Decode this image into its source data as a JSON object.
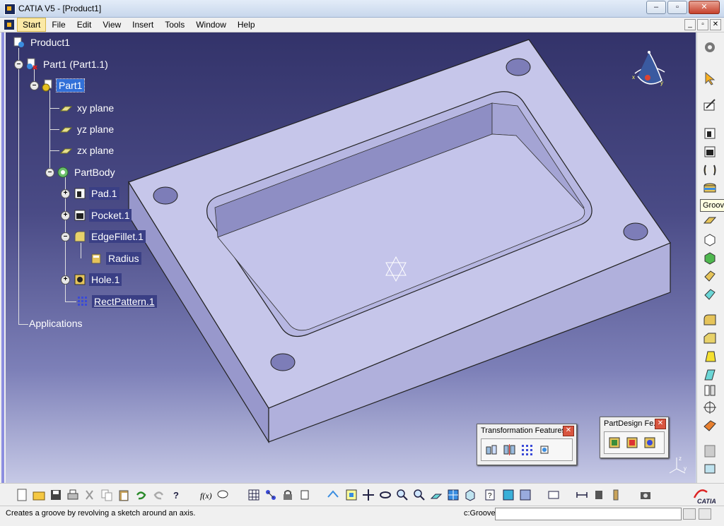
{
  "window": {
    "title": "CATIA V5 - [Product1]"
  },
  "menu": [
    "Start",
    "File",
    "Edit",
    "View",
    "Insert",
    "Tools",
    "Window",
    "Help"
  ],
  "tree": {
    "product": "Product1",
    "part_instance": "Part1 (Part1.1)",
    "part": "Part1",
    "xy_plane": "xy plane",
    "yz_plane": "yz plane",
    "zx_plane": "zx plane",
    "partbody": "PartBody",
    "pad": "Pad.1",
    "pocket": "Pocket.1",
    "edgefillet": "EdgeFillet.1",
    "radius": "Radius",
    "hole": "Hole.1",
    "rectpattern": "RectPattern.1",
    "applications": "Applications"
  },
  "tooltip": "Groove",
  "floating_toolbars": {
    "transformation": "Transformation Features",
    "partdesign": "PartDesign Fe..."
  },
  "status": {
    "message": "Creates a groove by revolving a sketch around an axis.",
    "command_label": "c:Groove",
    "command_value": ""
  },
  "colors": {
    "viewport_top": "#33336a",
    "viewport_bottom": "#c6c9e6",
    "part_top": "#c8c8ec",
    "part_side": "#a8a8d8",
    "selection": "#3270d8"
  }
}
